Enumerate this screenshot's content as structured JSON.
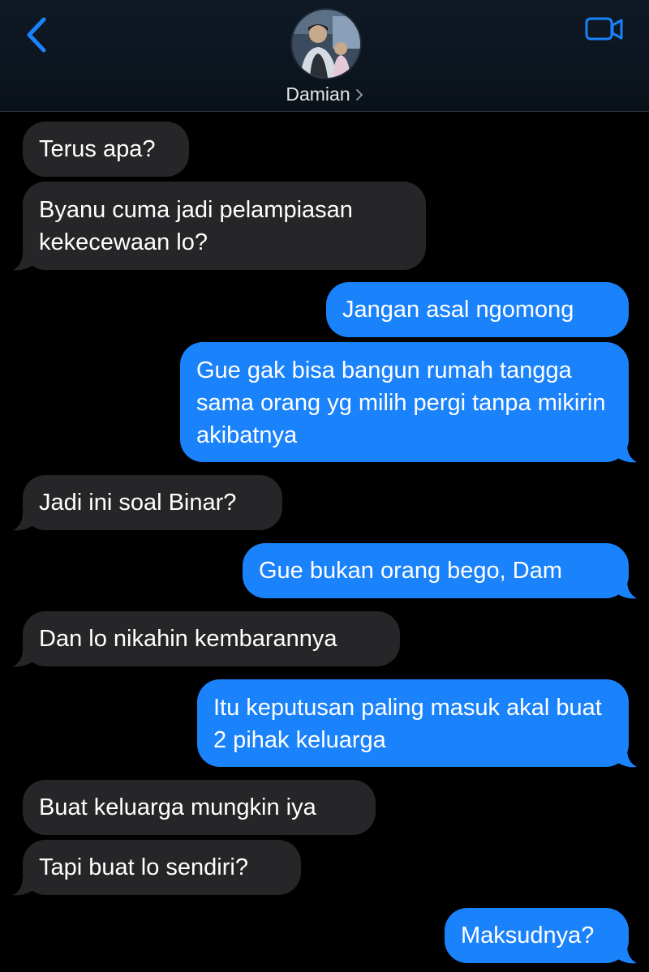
{
  "header": {
    "contact_name": "Damian",
    "back_icon": "chevron-left-icon",
    "video_icon": "video-camera-icon",
    "accent_color": "#1a82fb"
  },
  "messages": [
    {
      "dir": "in",
      "text": "Terus apa?"
    },
    {
      "dir": "in",
      "text": "Byanu cuma jadi pelampiasan kekecewaan lo?"
    },
    {
      "dir": "out",
      "text": "Jangan asal ngomong"
    },
    {
      "dir": "out",
      "text": "Gue gak bisa bangun rumah tangga sama orang yg milih pergi tanpa mikirin akibatnya"
    },
    {
      "dir": "in",
      "text": "Jadi ini soal Binar?"
    },
    {
      "dir": "out",
      "text": "Gue bukan orang bego, Dam"
    },
    {
      "dir": "in",
      "text": "Dan lo nikahin kembarannya"
    },
    {
      "dir": "out",
      "text": "Itu keputusan paling masuk akal buat 2 pihak keluarga"
    },
    {
      "dir": "in",
      "text": "Buat keluarga mungkin iya"
    },
    {
      "dir": "in",
      "text": "Tapi buat lo sendiri?"
    },
    {
      "dir": "out",
      "text": "Maksudnya?"
    }
  ]
}
